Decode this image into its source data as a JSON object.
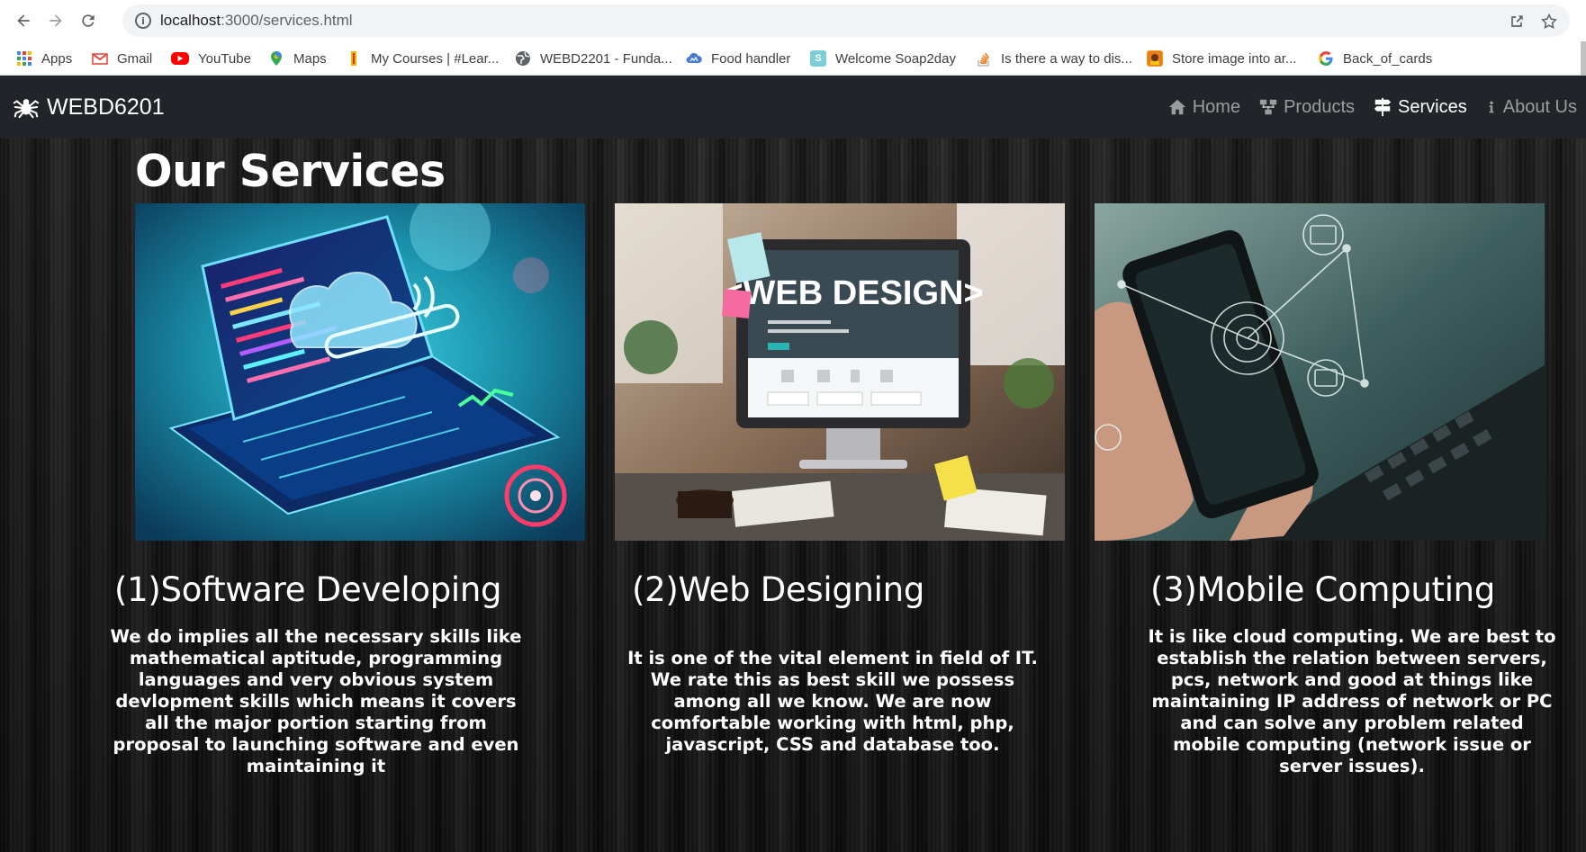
{
  "browser": {
    "url_host": "localhost",
    "url_path": ":3000/services.html",
    "bookmarks": [
      {
        "label": "Apps",
        "icon": "apps-grid-icon",
        "color": "#4285f4"
      },
      {
        "label": "Gmail",
        "icon": "gmail-icon",
        "color": "#ea4335"
      },
      {
        "label": "YouTube",
        "icon": "youtube-icon",
        "color": "#ff0000"
      },
      {
        "label": "Maps",
        "icon": "maps-pin-icon",
        "color": "#34a853"
      },
      {
        "label": "My Courses | #Lear...",
        "icon": "courses-icon",
        "color": "#f4b400"
      },
      {
        "label": "WEBD2201 - Funda...",
        "icon": "globe-icon",
        "color": "#5f6368"
      },
      {
        "label": "Food handler",
        "icon": "cloud-icon",
        "color": "#4a7bd0"
      },
      {
        "label": "Welcome Soap2day",
        "icon": "s-icon",
        "color": "#7ccfd6"
      },
      {
        "label": "Is there a way to dis...",
        "icon": "stackoverflow-icon",
        "color": "#f48024"
      },
      {
        "label": "Store image into ar...",
        "icon": "store-icon",
        "color": "#c0392b"
      },
      {
        "label": "Back_of_cards",
        "icon": "google-icon",
        "color": "#4285f4"
      }
    ]
  },
  "site": {
    "brand": "WEBD6201",
    "nav": [
      {
        "label": "Home",
        "icon": "home-icon",
        "active": false
      },
      {
        "label": "Products",
        "icon": "products-icon",
        "active": false
      },
      {
        "label": "Services",
        "icon": "services-icon",
        "active": true
      },
      {
        "label": "About Us",
        "icon": "info-icon",
        "active": false
      }
    ]
  },
  "page": {
    "title": "Our Services",
    "cards": [
      {
        "heading": "(1)Software Developing",
        "image": "laptop-cloud-image",
        "text": "We do implies all the necessary skills like mathematical aptitude, programming languages and very obvious system devlopment skills which means it covers all the major portion starting from proposal to launching software and even maintaining it"
      },
      {
        "heading": "(2)Web Designing",
        "image": "web-design-monitor-image",
        "image_caption": "<WEB DESIGN>",
        "text": "It is one of the vital element in field of IT. We rate this as best skill we possess among all we know. We are now comfortable working with html, php, javascript, CSS and database too."
      },
      {
        "heading": "(3)Mobile Computing",
        "image": "phone-network-image",
        "text": "It is like cloud computing. We are best to establish the relation between servers, pcs, network and good at things like maintaining IP address of network or PC and can solve any problem related mobile computing (network issue or server issues)."
      }
    ]
  }
}
